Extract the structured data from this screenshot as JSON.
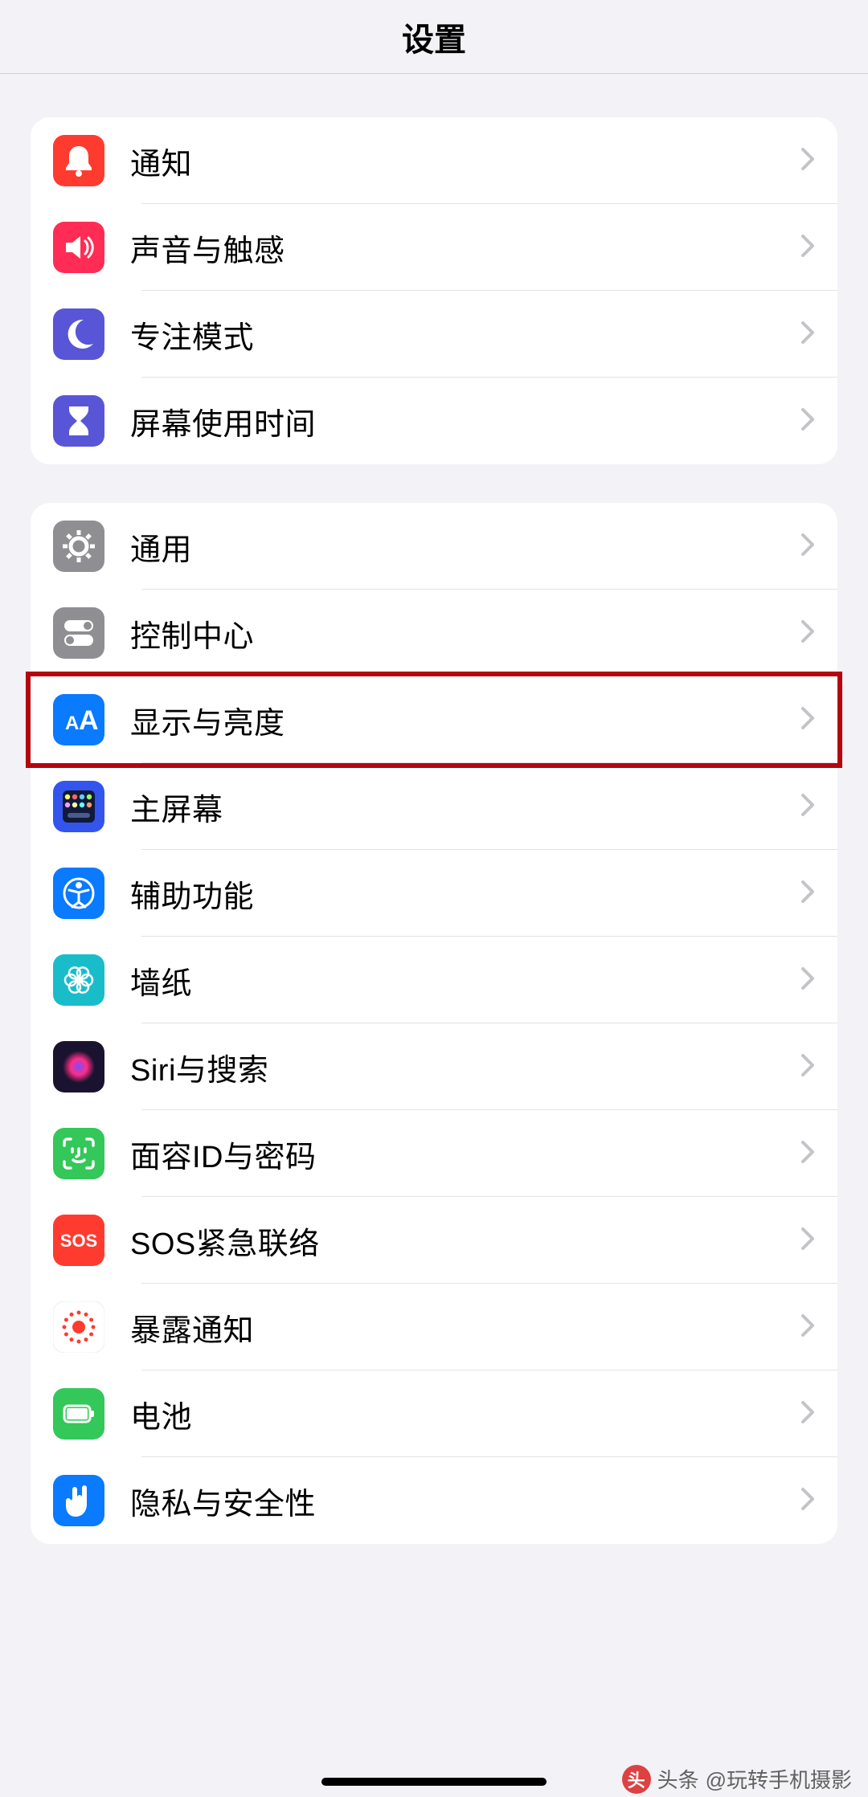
{
  "header": {
    "title": "设置"
  },
  "groups": [
    {
      "items": [
        {
          "id": "notifications",
          "label": "通知",
          "icon": "bell-icon",
          "bg": "#ff3b30"
        },
        {
          "id": "sounds",
          "label": "声音与触感",
          "icon": "speaker-icon",
          "bg": "#ff2d55"
        },
        {
          "id": "focus",
          "label": "专注模式",
          "icon": "moon-icon",
          "bg": "#5856d6"
        },
        {
          "id": "screentime",
          "label": "屏幕使用时间",
          "icon": "hourglass-icon",
          "bg": "#5856d6"
        }
      ]
    },
    {
      "items": [
        {
          "id": "general",
          "label": "通用",
          "icon": "gear-icon",
          "bg": "#8e8e93"
        },
        {
          "id": "controlcenter",
          "label": "控制中心",
          "icon": "switches-icon",
          "bg": "#8e8e93"
        },
        {
          "id": "display",
          "label": "显示与亮度",
          "icon": "text-size-icon",
          "bg": "#0a7aff",
          "highlight": true
        },
        {
          "id": "homescreen",
          "label": "主屏幕",
          "icon": "grid-icon",
          "bg": "#3355ee"
        },
        {
          "id": "accessibility",
          "label": "辅助功能",
          "icon": "accessibility-icon",
          "bg": "#0a7aff"
        },
        {
          "id": "wallpaper",
          "label": "墙纸",
          "icon": "flower-icon",
          "bg": "#18bdc9"
        },
        {
          "id": "siri",
          "label": "Siri与搜索",
          "icon": "siri-icon",
          "bg": "#1a1330"
        },
        {
          "id": "faceid",
          "label": "面容ID与密码",
          "icon": "face-id-icon",
          "bg": "#34c759"
        },
        {
          "id": "sos",
          "label": "SOS紧急联络",
          "icon": "sos-icon",
          "bg": "#ff3b30"
        },
        {
          "id": "exposure",
          "label": "暴露通知",
          "icon": "exposure-icon",
          "bg": "#ffffff"
        },
        {
          "id": "battery",
          "label": "电池",
          "icon": "battery-icon",
          "bg": "#34c759"
        },
        {
          "id": "privacy",
          "label": "隐私与安全性",
          "icon": "hand-icon",
          "bg": "#0a7aff"
        }
      ]
    }
  ],
  "watermark": {
    "prefix": "头条",
    "handle": "@玩转手机摄影"
  },
  "icons": {
    "sos_text": "SOS",
    "aa_text": "AA"
  }
}
